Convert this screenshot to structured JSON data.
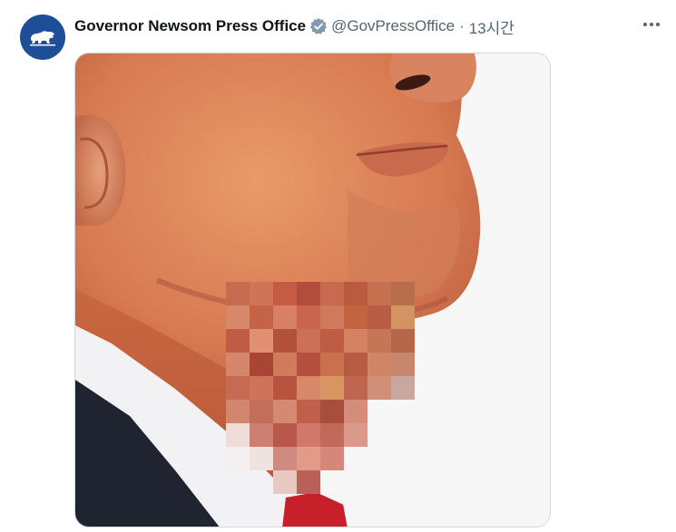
{
  "tweet": {
    "author": {
      "display_name": "Governor Newsom Press Office",
      "handle": "@GovPressOffice",
      "avatar_icon": "california-bear-icon",
      "avatar_color": "#1d4e97",
      "verified_icon": "verified-badge-icon",
      "verified_color": "#829aab"
    },
    "separator": "·",
    "timestamp": "13시간",
    "more_icon": "more-options-icon",
    "media": {
      "type": "photo",
      "pixelated_region": true
    }
  }
}
